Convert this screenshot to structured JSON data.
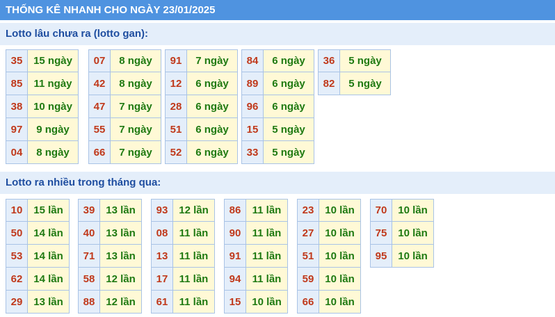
{
  "header": {
    "title": "THỐNG KÊ NHANH CHO NGÀY 23/01/2025"
  },
  "section1": {
    "title": "Lotto lâu chưa ra (lotto gan):",
    "groups": [
      [
        [
          "35",
          "15 ngày"
        ],
        [
          "85",
          "11 ngày"
        ],
        [
          "38",
          "10 ngày"
        ],
        [
          "97",
          "9 ngày"
        ],
        [
          "04",
          "8 ngày"
        ]
      ],
      [
        [
          "07",
          "8 ngày"
        ],
        [
          "42",
          "8 ngày"
        ],
        [
          "47",
          "7 ngày"
        ],
        [
          "55",
          "7 ngày"
        ],
        [
          "66",
          "7 ngày"
        ]
      ],
      [
        [
          "91",
          "7 ngày"
        ],
        [
          "12",
          "6 ngày"
        ],
        [
          "28",
          "6 ngày"
        ],
        [
          "51",
          "6 ngày"
        ],
        [
          "52",
          "6 ngày"
        ]
      ],
      [
        [
          "84",
          "6 ngày"
        ],
        [
          "89",
          "6 ngày"
        ],
        [
          "96",
          "6 ngày"
        ],
        [
          "15",
          "5 ngày"
        ],
        [
          "33",
          "5 ngày"
        ]
      ],
      [
        [
          "36",
          "5 ngày"
        ],
        [
          "82",
          "5 ngày"
        ]
      ]
    ]
  },
  "section2": {
    "title": "Lotto ra nhiều trong tháng qua:",
    "groups": [
      [
        [
          "10",
          "15 lần"
        ],
        [
          "50",
          "14 lần"
        ],
        [
          "53",
          "14 lần"
        ],
        [
          "62",
          "14 lần"
        ],
        [
          "29",
          "13 lần"
        ]
      ],
      [
        [
          "39",
          "13 lần"
        ],
        [
          "40",
          "13 lần"
        ],
        [
          "71",
          "13 lần"
        ],
        [
          "58",
          "12 lần"
        ],
        [
          "88",
          "12 lần"
        ]
      ],
      [
        [
          "93",
          "12 lần"
        ],
        [
          "08",
          "11 lần"
        ],
        [
          "13",
          "11 lần"
        ],
        [
          "17",
          "11 lần"
        ],
        [
          "61",
          "11 lần"
        ]
      ],
      [
        [
          "86",
          "11 lần"
        ],
        [
          "90",
          "11 lần"
        ],
        [
          "91",
          "11 lần"
        ],
        [
          "94",
          "11 lần"
        ],
        [
          "15",
          "10 lần"
        ]
      ],
      [
        [
          "23",
          "10 lần"
        ],
        [
          "27",
          "10 lần"
        ],
        [
          "51",
          "10 lần"
        ],
        [
          "59",
          "10 lần"
        ],
        [
          "66",
          "10 lần"
        ]
      ],
      [
        [
          "70",
          "10 lần"
        ],
        [
          "75",
          "10 lần"
        ],
        [
          "95",
          "10 lần"
        ]
      ]
    ]
  }
}
